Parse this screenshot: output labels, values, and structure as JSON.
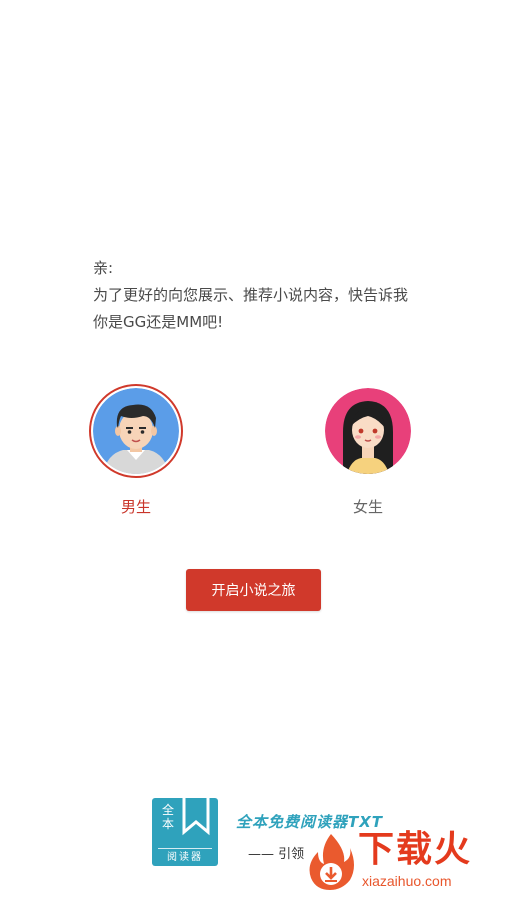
{
  "greeting": {
    "line1": "亲:",
    "line2": "为了更好的向您展示、推荐小说内容，快告诉我",
    "line3": "你是GG还是MM吧!"
  },
  "genders": {
    "male": {
      "label": "男生",
      "selected": true
    },
    "female": {
      "label": "女生",
      "selected": false
    }
  },
  "start_button": {
    "label": "开启小说之旅"
  },
  "brand": {
    "logo_top": "全本",
    "logo_sub": "阅读器",
    "name": "全本免费阅读器TXT",
    "slogan": "—— 引领"
  },
  "watermark": {
    "title": "下载火",
    "url": "xiazaihuo.com"
  },
  "colors": {
    "accent": "#d0392b",
    "brand": "#2fa2bc",
    "watermark": "#e43a1d"
  }
}
